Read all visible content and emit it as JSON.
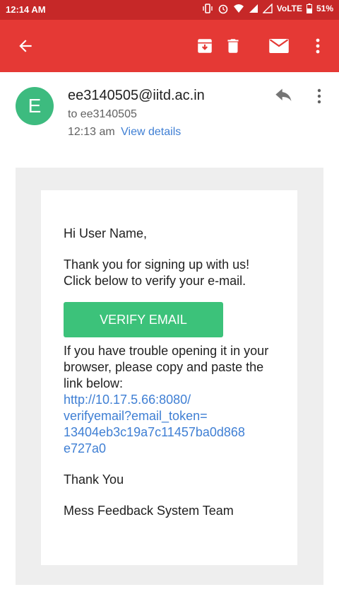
{
  "status_bar": {
    "time": "12:14 AM",
    "network": "VoLTE",
    "battery": "51%"
  },
  "app_bar": {
    "icons": [
      "back-arrow-icon",
      "archive-icon",
      "delete-icon",
      "mail-icon",
      "more-vert-icon"
    ]
  },
  "header": {
    "avatar_letter": "E",
    "avatar_color": "#3dbb7f",
    "sender": "ee3140505@iitd.ac.in",
    "recipient": "to ee3140505",
    "time": "12:13 am",
    "view_details": "View details"
  },
  "body": {
    "greeting": "Hi User Name,",
    "intro_line1": "Thank you for signing up with us!",
    "intro_line2": "Click below to verify your e-mail.",
    "button_label": "VERIFY EMAIL",
    "trouble_text": "If you have trouble opening it in your browser, please copy and paste the link below:",
    "link": "http://10.17.5.66:8080/verifyemail?email_token=13404eb3c19a7c11457ba0d868e727a0",
    "link_lines": [
      "http://10.17.5.66:8080/",
      "verifyemail?email_token=",
      "13404eb3c19a7c11457ba0d868",
      "e727a0"
    ],
    "thanks": "Thank You",
    "signature": "Mess Feedback System Team"
  },
  "colors": {
    "app_bar": "#e53935",
    "status_bar": "#c62828",
    "button": "#3cc27a",
    "link": "#3f7fd4"
  }
}
